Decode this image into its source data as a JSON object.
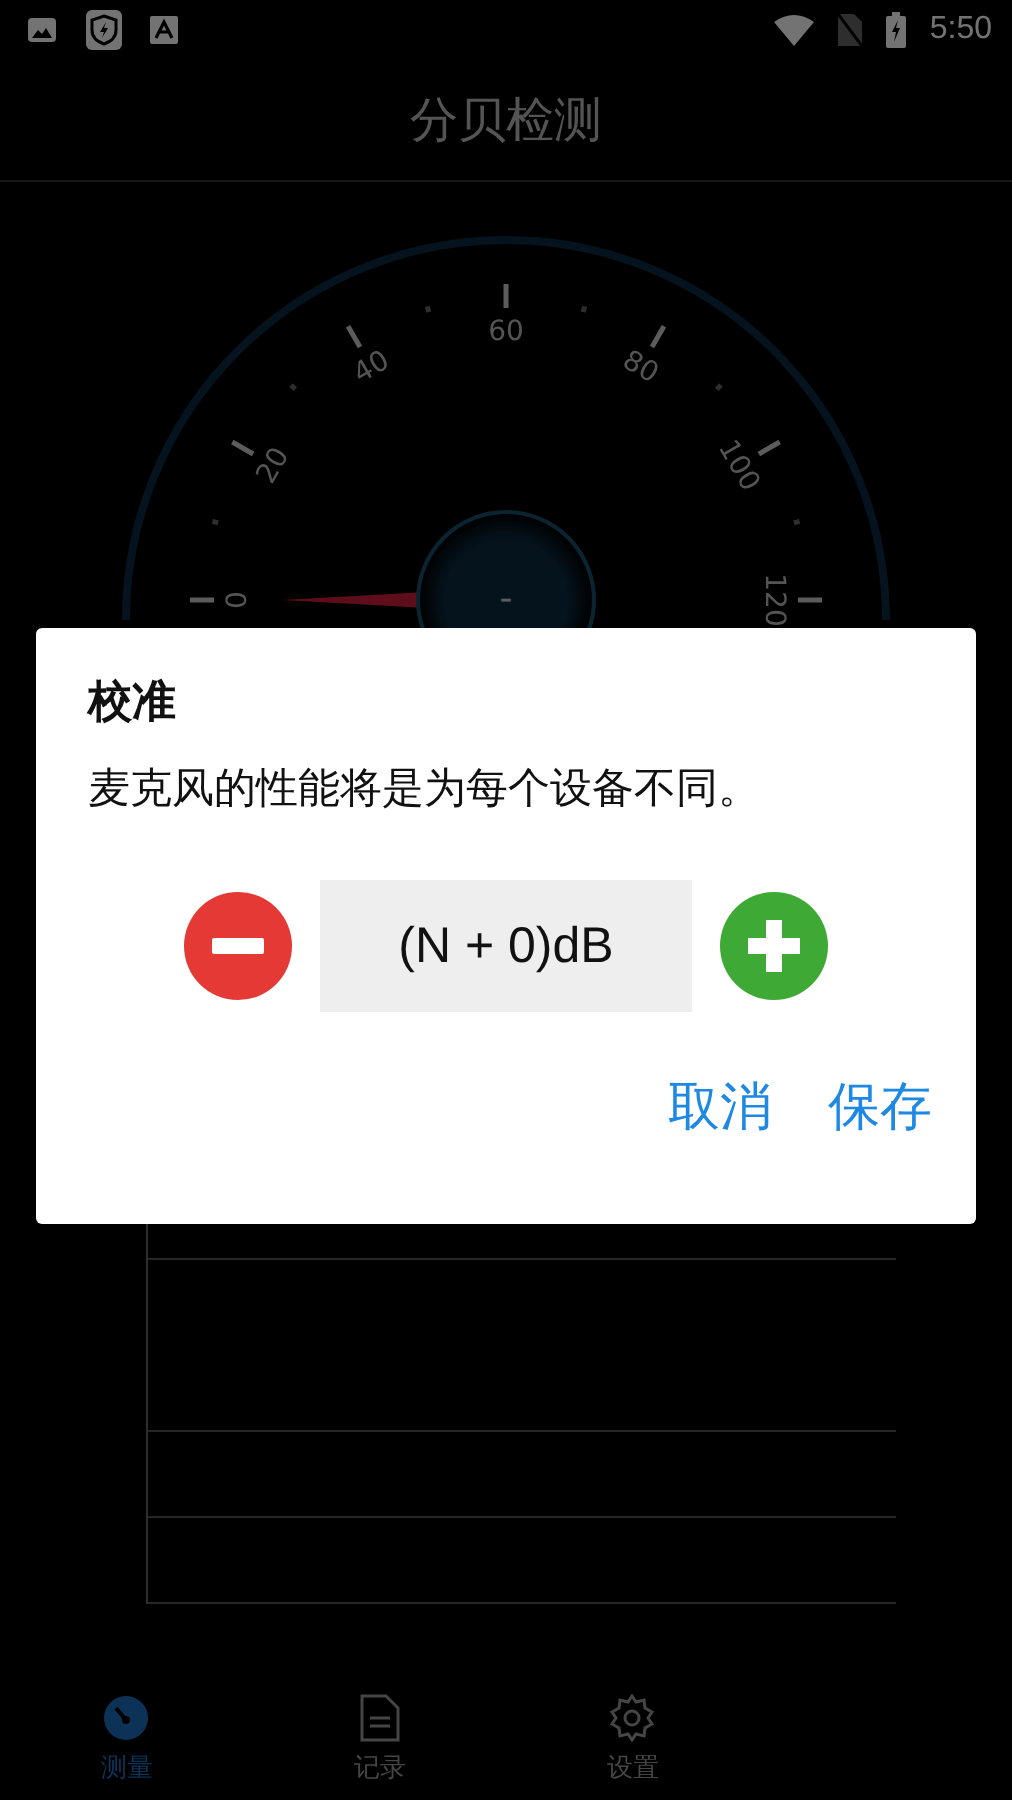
{
  "status_bar": {
    "time": "5:50"
  },
  "header": {
    "title": "分贝检测"
  },
  "gauge": {
    "scale": [
      "0",
      "20",
      "40",
      "60",
      "80",
      "100",
      "120"
    ],
    "reading": "-"
  },
  "dialog": {
    "title": "校准",
    "message": "麦克风的性能将是为每个设备不同。",
    "value": "(N + 0)dB",
    "buttons": [
      "取消",
      "保存"
    ]
  },
  "bottom_nav": [
    {
      "label": "测量",
      "kind": "gauge",
      "selected": true
    },
    {
      "label": "记录",
      "kind": "document",
      "selected": false
    },
    {
      "label": "设置",
      "kind": "settings",
      "selected": false
    }
  ]
}
